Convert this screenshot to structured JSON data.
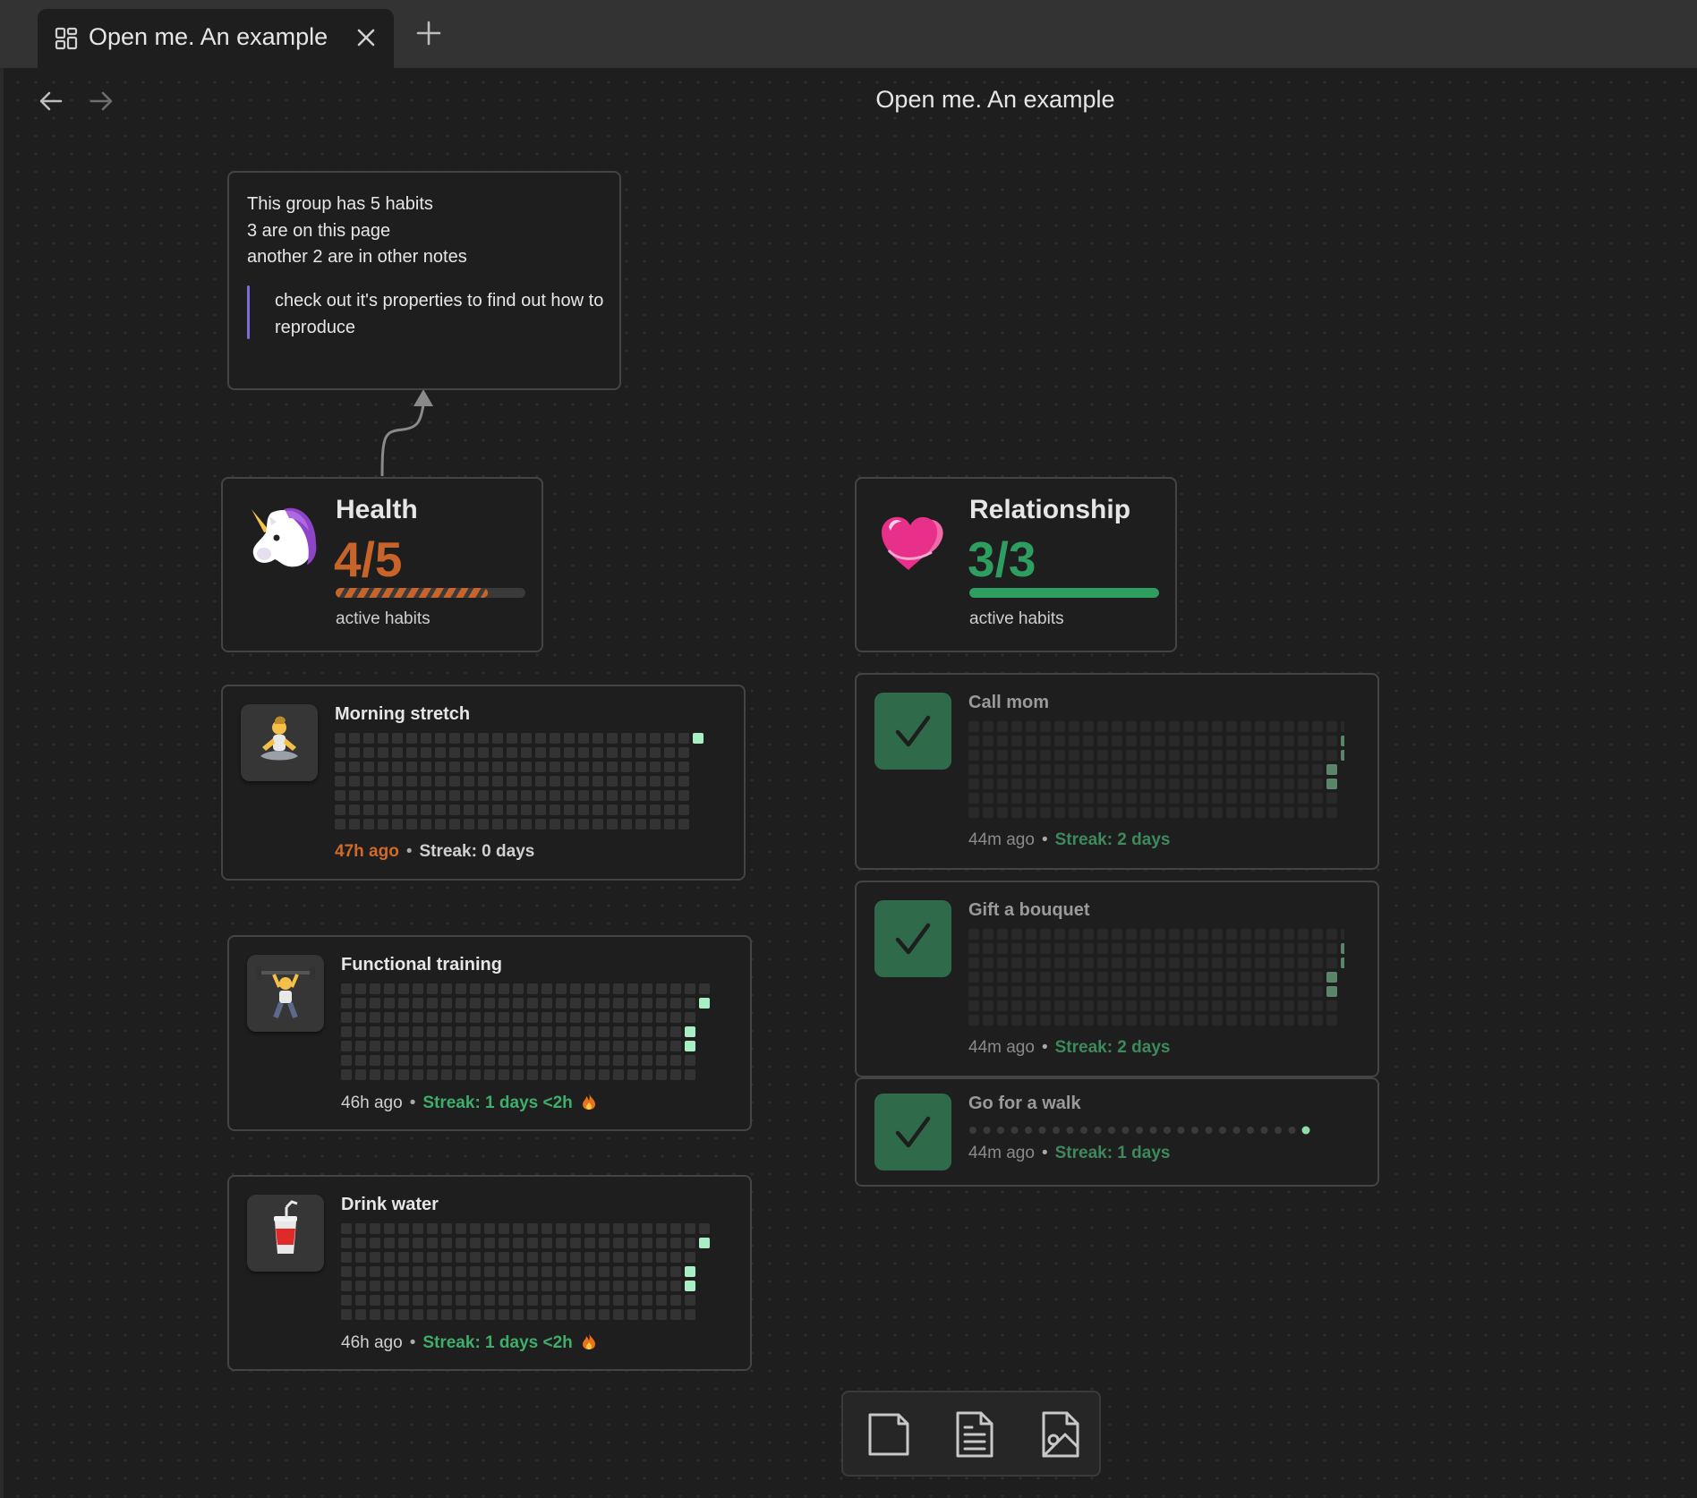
{
  "tab": {
    "title": "Open me. An example",
    "icon": "canvas-icon"
  },
  "page_title": "Open me. An example",
  "note": {
    "lines": [
      "This group has 5 habits",
      "3 are on this page",
      "another 2 are in other notes"
    ],
    "quote": "check out it's properties to find out how to reproduce"
  },
  "groups": {
    "health": {
      "emoji": "unicorn-emoji",
      "title": "Health",
      "count": "4/5",
      "progress": 0.8,
      "subtitle": "active habits",
      "color": "#c8642a"
    },
    "relationship": {
      "emoji": "two-hearts-emoji",
      "title": "Relationship",
      "count": "3/3",
      "progress": 1.0,
      "subtitle": "active habits",
      "color": "#2e9e60"
    }
  },
  "habits": {
    "morning_stretch": {
      "icon": "meditation-emoji",
      "title": "Morning stretch",
      "ago": "47h ago",
      "streak": "Streak: 0 days"
    },
    "functional_training": {
      "icon": "weightlifter-emoji",
      "title": "Functional training",
      "ago": "46h ago",
      "streak": "Streak: 1 days <2h",
      "streak_icon": "fire-icon"
    },
    "drink_water": {
      "icon": "cup-with-straw-emoji",
      "title": "Drink water",
      "ago": "46h ago",
      "streak": "Streak: 1 days <2h",
      "streak_icon": "fire-icon"
    },
    "call_mom": {
      "icon": "checkmark-icon",
      "title": "Call mom",
      "ago": "44m ago",
      "streak": "Streak: 2 days"
    },
    "gift_bouquet": {
      "icon": "checkmark-icon",
      "title": "Gift a bouquet",
      "ago": "44m ago",
      "streak": "Streak: 2 days"
    },
    "go_walk": {
      "icon": "checkmark-icon",
      "title": "Go for a walk",
      "ago": "44m ago",
      "streak": "Streak: 1 days"
    }
  },
  "separator": "•",
  "toolbar": {
    "items": [
      "new-card-icon",
      "new-note-icon",
      "add-media-icon"
    ]
  },
  "colors": {
    "accent_green": "#3fae6a",
    "accent_orange": "#d06a2a",
    "quote_bar": "#7b6cd9"
  }
}
